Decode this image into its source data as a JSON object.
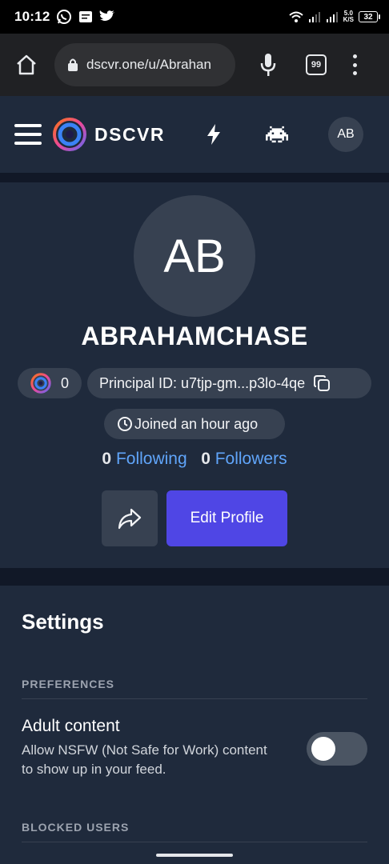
{
  "status_bar": {
    "time": "10:12",
    "speed_value": "5.0",
    "speed_unit": "K/S",
    "battery": "32",
    "left_icons": [
      "whatsapp-icon",
      "message-icon",
      "twitter-icon"
    ],
    "right_icons": [
      "wifi-icon",
      "signal-icon",
      "signal-icon",
      "battery-icon"
    ]
  },
  "browser": {
    "url": "dscvr.one/u/Abrahan",
    "tab_count": "99"
  },
  "app_header": {
    "brand": "DSCVR",
    "avatar_initials": "AB"
  },
  "profile": {
    "avatar_initials": "AB",
    "username": "ABRAHAMCHASE",
    "points": "0",
    "principal_id": "Principal ID: u7tjp-gm...p3lo-4qe",
    "joined": "Joined an hour ago",
    "following_count": "0",
    "following_label": "Following",
    "followers_count": "0",
    "followers_label": "Followers",
    "edit_button": "Edit Profile"
  },
  "settings": {
    "title": "Settings",
    "preferences_label": "PREFERENCES",
    "adult_content": {
      "name": "Adult content",
      "description": "Allow NSFW (Not Safe for Work) content to show up in your feed.",
      "enabled": false
    },
    "blocked_users_label": "BLOCKED USERS"
  },
  "colors": {
    "page_bg": "#111827",
    "card_bg": "#1f2a3c",
    "chip_bg": "#374151",
    "accent": "#4f46e5",
    "link": "#60a5fa"
  }
}
